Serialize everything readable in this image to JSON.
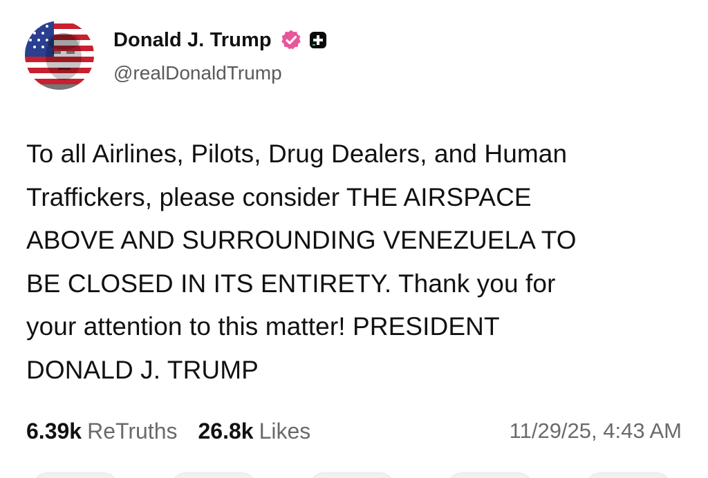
{
  "author": {
    "display_name": "Donald J. Trump",
    "handle": "@realDonaldTrump",
    "verified_icon": "verified-badge-icon",
    "verified_color": "#e8579b",
    "plus_icon": "truth-plus-icon"
  },
  "post": {
    "text": "To all Airlines, Pilots, Drug Dealers, and Human\nTraffickers, please consider THE AIRSPACE\nABOVE AND SURROUNDING VENEZUELA TO\nBE CLOSED IN ITS ENTIRETY. Thank you for\nyour attention to this matter! PRESIDENT\nDONALD J. TRUMP"
  },
  "stats": {
    "retruths_count": "6.39k",
    "retruths_label": "ReTruths",
    "likes_count": "26.8k",
    "likes_label": "Likes"
  },
  "timestamp": "11/29/25, 4:43 AM"
}
